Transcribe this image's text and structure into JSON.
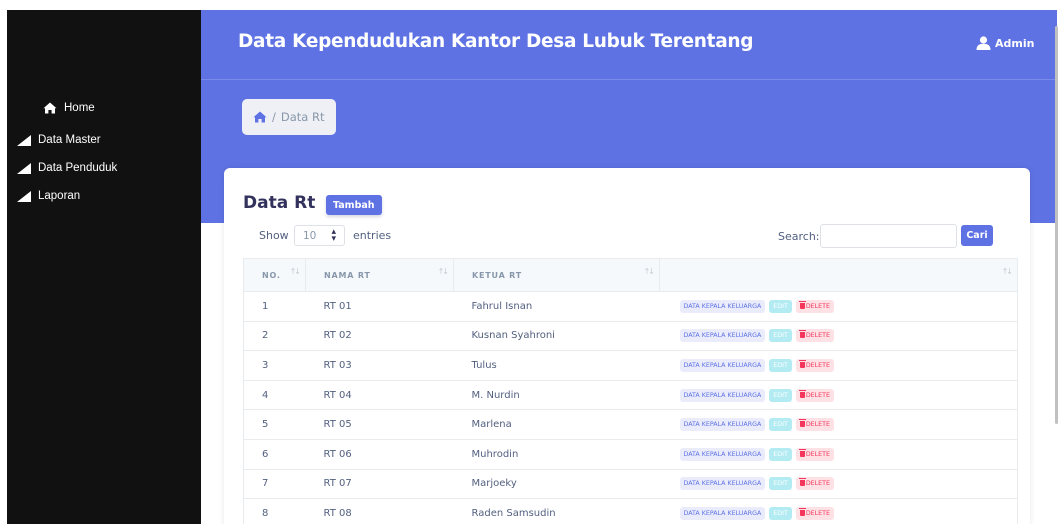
{
  "app_title": "Data Kependudukan Kantor Desa Lubuk Terentang",
  "user": {
    "name": "Admin",
    "icon": "user-icon"
  },
  "sidebar": {
    "items": [
      {
        "label": "Home",
        "icon": "home-icon"
      },
      {
        "label": "Data Master",
        "icon": "triangle-icon"
      },
      {
        "label": "Data Penduduk",
        "icon": "triangle-icon"
      },
      {
        "label": "Laporan",
        "icon": "triangle-icon"
      }
    ]
  },
  "breadcrumb": {
    "icon": "home-icon",
    "separator": "/",
    "current": "Data Rt"
  },
  "card": {
    "title": "Data Rt",
    "add_label": "Tambah",
    "show_label": "Show",
    "entries_value": "10",
    "entries_label": "entries",
    "search_label": "Search:",
    "search_value": "",
    "search_button": "Cari"
  },
  "table": {
    "headers": [
      "NO.",
      "NAMA RT",
      "KETUA RT",
      ""
    ],
    "action_labels": {
      "kk": "DATA KEPALA KELUARGA",
      "edit": "EDIT",
      "delete": "DELETE"
    },
    "rows": [
      {
        "no": "1",
        "nama": "RT 01",
        "ketua": "Fahrul Isnan"
      },
      {
        "no": "2",
        "nama": "RT 02",
        "ketua": "Kusnan Syahroni"
      },
      {
        "no": "3",
        "nama": "RT 03",
        "ketua": "Tulus"
      },
      {
        "no": "4",
        "nama": "RT 04",
        "ketua": "M. Nurdin"
      },
      {
        "no": "5",
        "nama": "RT 05",
        "ketua": "Marlena"
      },
      {
        "no": "6",
        "nama": "RT 06",
        "ketua": "Muhrodin"
      },
      {
        "no": "7",
        "nama": "RT 07",
        "ketua": "Marjoeky"
      },
      {
        "no": "8",
        "nama": "RT 08",
        "ketua": "Raden Samsudin"
      }
    ]
  },
  "colors": {
    "primary": "#5e72e4",
    "sidebar": "#111111",
    "danger": "#f5365c",
    "info": "#11cdef",
    "text": "#525f7f",
    "heading": "#32325d"
  }
}
